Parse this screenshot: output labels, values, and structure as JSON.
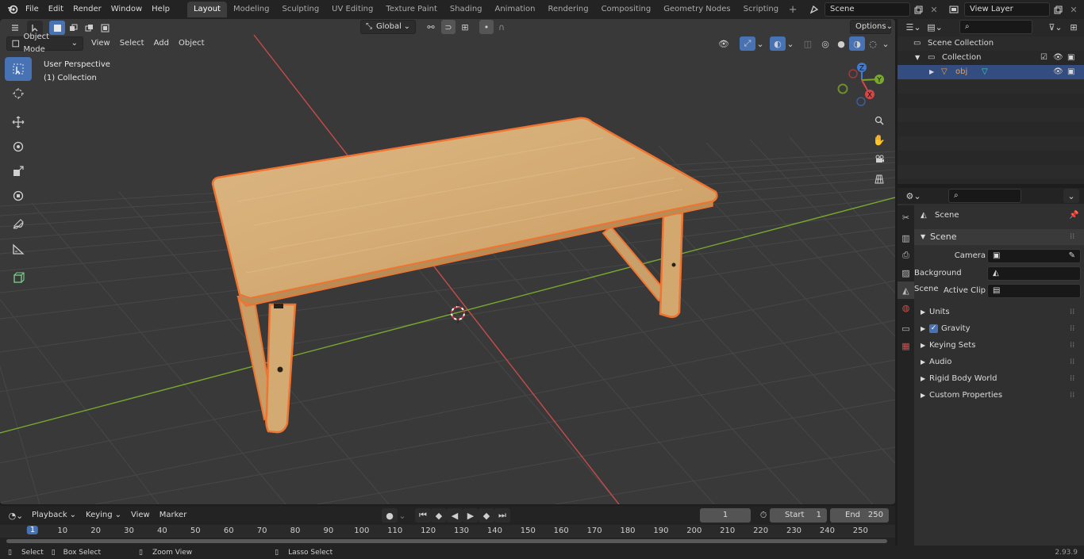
{
  "menu": {
    "items": [
      "File",
      "Edit",
      "Render",
      "Window",
      "Help"
    ]
  },
  "workspaces": {
    "tabs": [
      "Layout",
      "Modeling",
      "Sculpting",
      "UV Editing",
      "Texture Paint",
      "Shading",
      "Animation",
      "Rendering",
      "Compositing",
      "Geometry Nodes",
      "Scripting"
    ],
    "add": "+"
  },
  "scene_field": "Scene",
  "view_layer_field": "View Layer",
  "viewport": {
    "mode": "Object Mode",
    "menus": [
      "View",
      "Select",
      "Add",
      "Object"
    ],
    "transform_orientation": "Global",
    "options": "Options",
    "info_line1": "User Perspective",
    "info_line2": "(1) Collection",
    "gizmo": {
      "x": "X",
      "y": "Y",
      "z": "Z"
    },
    "colors": {
      "background": "#393939",
      "grid": "#4a4a4a",
      "x_axis": "#c84b4b",
      "y_axis": "#7aa82e",
      "selection": "#f0742f",
      "wood": "#d6ae7a"
    }
  },
  "timeline": {
    "menus": [
      "Playback",
      "Keying",
      "View",
      "Marker"
    ],
    "current_frame": "1",
    "start_label": "Start",
    "start_value": "1",
    "end_label": "End",
    "end_value": "250",
    "ruler": [
      "1",
      "10",
      "20",
      "30",
      "40",
      "50",
      "60",
      "70",
      "80",
      "90",
      "100",
      "110",
      "120",
      "130",
      "140",
      "150",
      "160",
      "170",
      "180",
      "190",
      "200",
      "210",
      "220",
      "230",
      "240",
      "250"
    ]
  },
  "statusbar": {
    "select": "Select",
    "box_select": "Box Select",
    "zoom_view": "Zoom View",
    "lasso_select": "Lasso Select",
    "version": "2.93.9"
  },
  "outliner": {
    "scene_collection": "Scene Collection",
    "collection": "Collection",
    "object": "obj"
  },
  "properties": {
    "header": "Scene",
    "section": "Scene",
    "camera_label": "Camera",
    "background_scene_label": "Background Scene",
    "active_clip_label": "Active Clip",
    "panels": [
      "Units",
      "Gravity",
      "Keying Sets",
      "Audio",
      "Rigid Body World",
      "Custom Properties"
    ]
  }
}
